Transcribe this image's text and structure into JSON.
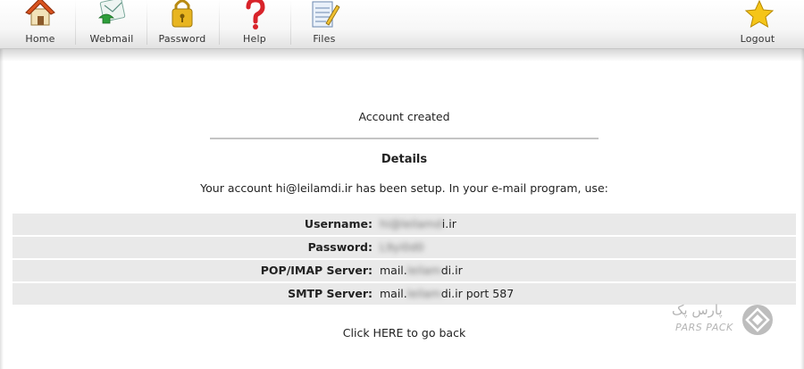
{
  "toolbar": {
    "items": [
      {
        "label": "Home",
        "icon": "house-icon"
      },
      {
        "label": "Webmail",
        "icon": "mail-icon"
      },
      {
        "label": "Password",
        "icon": "padlock-icon"
      },
      {
        "label": "Help",
        "icon": "question-mark-icon"
      },
      {
        "label": "Files",
        "icon": "notepad-icon"
      }
    ],
    "logout": {
      "label": "Logout",
      "icon": "star-icon"
    }
  },
  "main": {
    "status": "Account created",
    "details_title": "Details",
    "intro": "Your account hi@leilamdi.ir has been setup. In your e-mail program, use:",
    "rows": [
      {
        "label": "Username:",
        "value_hidden": "hi@leilamd",
        "value_visible": "i.ir",
        "suffix": ""
      },
      {
        "label": "Password:",
        "value_hidden": "L9yi0d0",
        "value_visible": "",
        "suffix": ""
      },
      {
        "label": "POP/IMAP Server:",
        "value_prefix": "mail.",
        "value_hidden": "leilam",
        "value_visible": "di.ir",
        "suffix": ""
      },
      {
        "label": "SMTP Server:",
        "value_prefix": "mail.",
        "value_hidden": "leilam",
        "value_visible": "di.ir",
        "suffix": " port 587"
      }
    ],
    "go_back": "Click HERE to go back"
  },
  "watermark": {
    "text_fa": "پارس پک",
    "text_en": "PARS PACK"
  },
  "colors": {
    "row_background": "#e9e9e9",
    "rule": "#c4c4c4",
    "house_roof": "#d9531e",
    "padlock": "#e8b520",
    "help": "#d8232a",
    "star": "#f5c518"
  }
}
